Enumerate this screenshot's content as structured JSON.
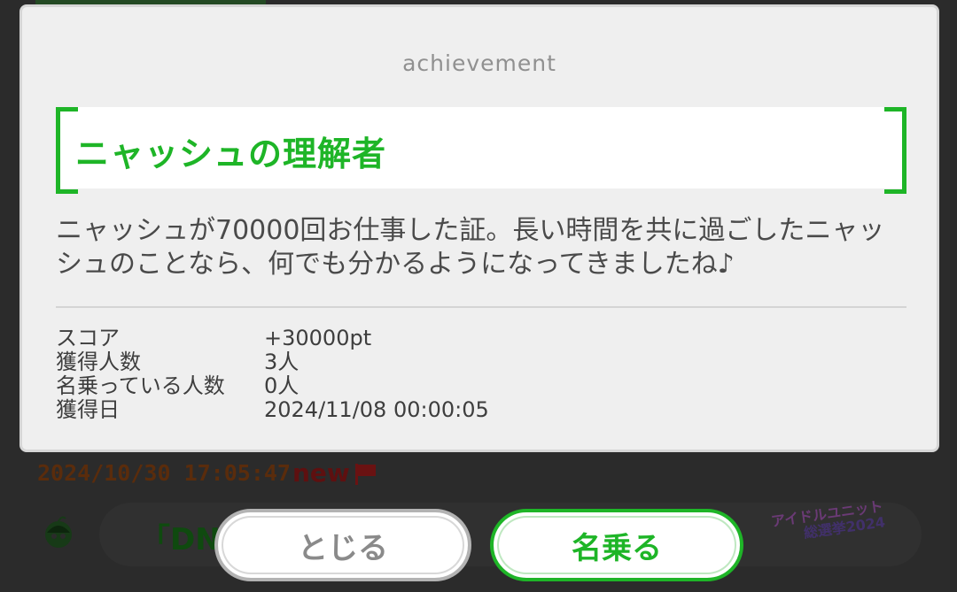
{
  "background": {
    "timestamp": "2024/10/30 17:05:47",
    "new_badge": "new",
    "message_preview": "「DN3",
    "banner_line1": "アイドルユニット",
    "banner_line2": "総選挙2024"
  },
  "modal": {
    "label": "achievement",
    "title": "ニャッシュの理解者",
    "description": "ニャッシュが70000回お仕事した証。長い時間を共に過ごしたニャッシュのことなら、何でも分かるようになってきましたね♪",
    "stats": [
      {
        "label": "スコア",
        "value": "+30000pt"
      },
      {
        "label": "獲得人数",
        "value": "3人"
      },
      {
        "label": "名乗っている人数",
        "value": "0人"
      },
      {
        "label": "獲得日",
        "value": "2024/11/08 00:00:05"
      }
    ]
  },
  "buttons": {
    "close_label": "とじる",
    "name_label": "名乗る"
  },
  "colors": {
    "accent": "#1eb527",
    "modal_bg": "#efefef"
  },
  "icons": [
    "flag-icon",
    "avatar-icon"
  ]
}
